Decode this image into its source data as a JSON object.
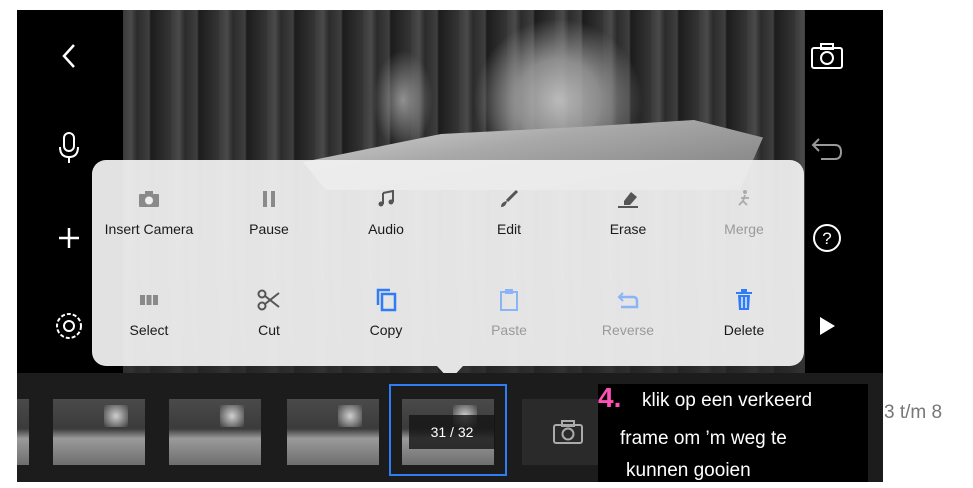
{
  "menu": {
    "row1": [
      {
        "label": "Insert Camera",
        "icon": "camera-icon"
      },
      {
        "label": "Pause",
        "icon": "pause-icon"
      },
      {
        "label": "Audio",
        "icon": "music-note-icon"
      },
      {
        "label": "Edit",
        "icon": "brush-icon"
      },
      {
        "label": "Erase",
        "icon": "eraser-icon"
      },
      {
        "label": "Merge",
        "icon": "merge-icon"
      }
    ],
    "row2": [
      {
        "label": "Select",
        "icon": "select-frames-icon"
      },
      {
        "label": "Cut",
        "icon": "scissors-icon"
      },
      {
        "label": "Copy",
        "icon": "copy-icon"
      },
      {
        "label": "Paste",
        "icon": "clipboard-icon"
      },
      {
        "label": "Reverse",
        "icon": "reverse-icon"
      },
      {
        "label": "Delete",
        "icon": "trash-icon"
      }
    ]
  },
  "timeline": {
    "frame_counter": "31 / 32"
  },
  "annotation": {
    "number": "4.",
    "line1": "klik op een verkeerd",
    "line2": "frame om ’m weg te",
    "line3": "kunnen gooien"
  },
  "outside_text": "3 t/m 8",
  "colors": {
    "accent_blue": "#2f7cf6",
    "annotation_pink": "#ff4fb8",
    "disabled_gray": "#9a9a9a"
  }
}
